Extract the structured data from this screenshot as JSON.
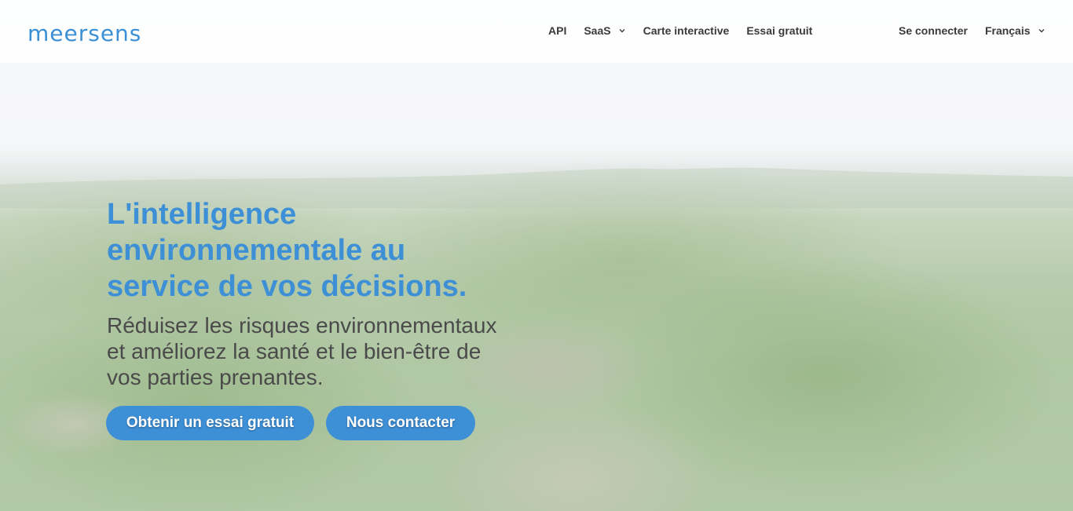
{
  "logo": {
    "text": "meersens"
  },
  "nav": {
    "items": [
      {
        "label": "API",
        "dropdown": false
      },
      {
        "label": "SaaS",
        "dropdown": true
      },
      {
        "label": "Carte interactive",
        "dropdown": false
      },
      {
        "label": "Essai gratuit",
        "dropdown": false
      }
    ],
    "login_label": "Se connecter",
    "language_label": "Français"
  },
  "hero": {
    "headline_lines": [
      "L'intelligence",
      "environnementale au",
      "service de vos décisions."
    ],
    "subtext_lines": [
      "Réduisez les risques environnementaux",
      "et améliorez la santé et le bien-être de",
      "vos parties prenantes."
    ],
    "cta_trial": "Obtenir un essai gratuit",
    "cta_contact": "Nous contacter"
  },
  "colors": {
    "brand_blue": "#3d8fd6",
    "nav_text": "#3a3a3a",
    "body_text": "#4a4a4a"
  },
  "icons": {
    "dropdown": "chevron-down-icon"
  }
}
